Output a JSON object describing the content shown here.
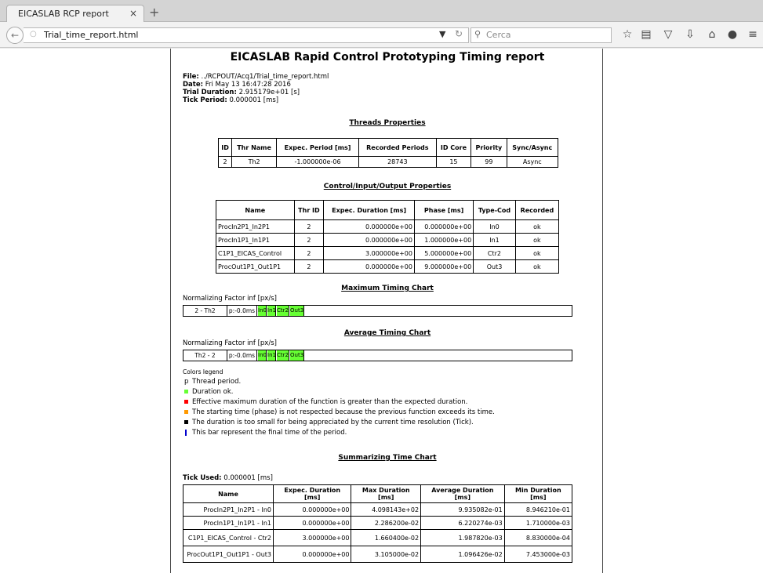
{
  "browser": {
    "tab_title": "EICASLAB RCP report",
    "tab_close": "×",
    "new_tab": "+",
    "url": "Trial_time_report.html",
    "search_placeholder": "Cerca"
  },
  "report": {
    "title": "EICASLAB Rapid Control Prototyping Timing report",
    "file_label": "File:",
    "file_value": " ../RCPOUT/Acq1/Trial_time_report.html",
    "date_label": "Date:",
    "date_value": " Fri May 13 16:47:28 2016",
    "duration_label": "Trial Duration:",
    "duration_value": " 2.915179e+01 [s]",
    "tick_label": "Tick Period:",
    "tick_value": " 0.000001 [ms]"
  },
  "threads": {
    "title": "Threads Properties",
    "headers": [
      "ID",
      "Thr Name",
      "Expec. Period [ms]",
      "Recorded Periods",
      "ID Core",
      "Priority",
      "Sync/Async"
    ],
    "rows": [
      [
        "2",
        "Th2",
        "-1.000000e-06",
        "28743",
        "15",
        "99",
        "Async"
      ]
    ]
  },
  "cio": {
    "title": "Control/Input/Output Properties",
    "headers": [
      "Name",
      "Thr ID",
      "Expec. Duration [ms]",
      "Phase [ms]",
      "Type-Cod",
      "Recorded"
    ],
    "rows": [
      [
        "ProcIn2P1_In2P1",
        "2",
        "0.000000e+00",
        "0.000000e+00",
        "In0",
        "ok"
      ],
      [
        "ProcIn1P1_In1P1",
        "2",
        "0.000000e+00",
        "1.000000e+00",
        "In1",
        "ok"
      ],
      [
        "C1P1_EICAS_Control",
        "2",
        "3.000000e+00",
        "5.000000e+00",
        "Ctr2",
        "ok"
      ],
      [
        "ProcOut1P1_Out1P1",
        "2",
        "0.000000e+00",
        "9.000000e+00",
        "Out3",
        "ok"
      ]
    ]
  },
  "max_chart": {
    "title": "Maximum Timing Chart",
    "norm": "Normalizing Factor inf [px/s]",
    "label": "2 - Th2",
    "period": "p:-0.0ms",
    "segments": [
      "In0",
      "In1",
      "Ctr2",
      "Out3"
    ]
  },
  "avg_chart": {
    "title": "Average Timing Chart",
    "norm": "Normalizing Factor inf [px/s]",
    "label": "Th2 - 2",
    "period": "p:-0.0ms",
    "segments": [
      "In0",
      "In1",
      "Ctr2",
      "Out3"
    ]
  },
  "legend": {
    "title": "Colors legend",
    "p_symbol": "p",
    "items": [
      "Thread period.",
      "Duration ok.",
      "Effective maximum duration of the function is greater than the expected duration.",
      "The starting time (phase) is not respected because the previous function exceeds its time.",
      "The duration is too small for being appreciated by the current time resolution (Tick).",
      "This bar represent the final time of the period."
    ],
    "colors": [
      "#66ff33",
      "#ff0000",
      "#ff9900",
      "#000000",
      "#0000cc"
    ]
  },
  "summary": {
    "title": "Summarizing Time Chart",
    "tick_label": "Tick Used:",
    "tick_value": " 0.000001 [ms]",
    "headers": [
      "Name",
      "Expec. Duration [ms]",
      "Max Duration [ms]",
      "Average Duration [ms]",
      "Min Duration [ms]"
    ],
    "rows": [
      [
        "ProcIn2P1_In2P1 - In0",
        "0.000000e+00",
        "4.098143e+02",
        "9.935082e-01",
        "8.946210e-01"
      ],
      [
        "ProcIn1P1_In1P1 - In1",
        "0.000000e+00",
        "2.286200e-02",
        "6.220274e-03",
        "1.710000e-03"
      ],
      [
        "C1P1_EICAS_Control - Ctr2",
        "3.000000e+00",
        "1.660400e-02",
        "1.987820e-03",
        "8.830000e-04"
      ],
      [
        "ProcOut1P1_Out1P1 - Out3",
        "0.000000e+00",
        "3.105000e-02",
        "1.096426e-02",
        "7.453000e-03"
      ]
    ]
  }
}
